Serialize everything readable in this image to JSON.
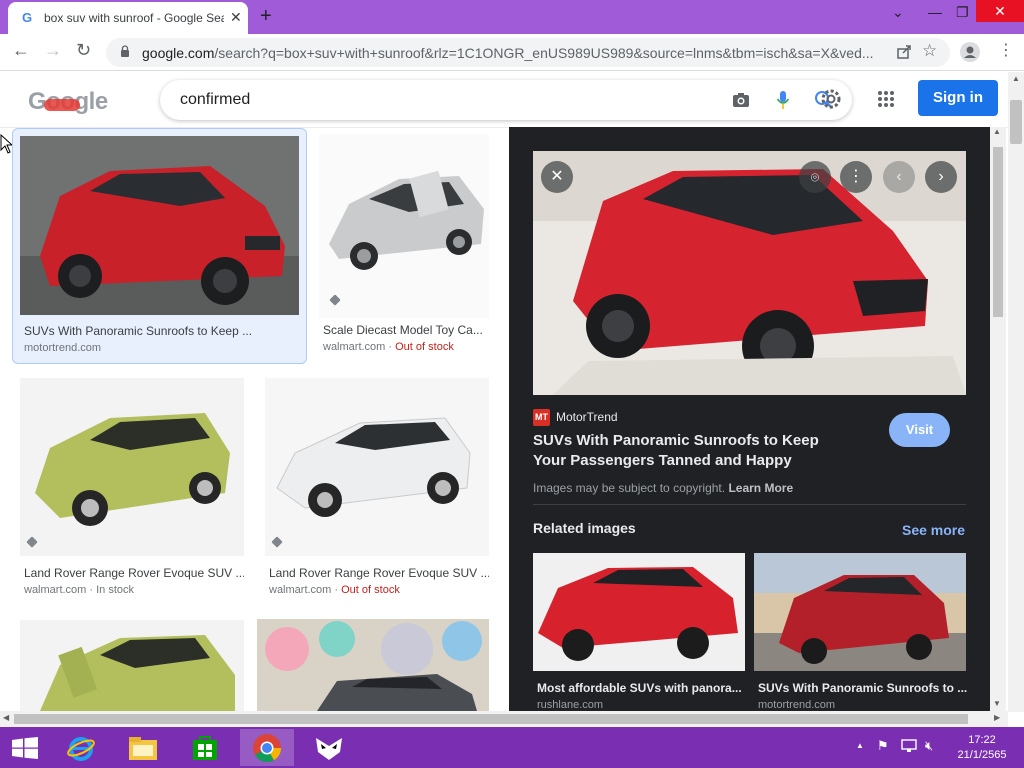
{
  "browser": {
    "tab_title": "box suv with sunroof - Google Search",
    "tab_favicon": "G",
    "url_main": "google.com",
    "url_rest": "/search?q=box+suv+with+sunroof&rlz=1C1ONGR_enUS989US989&source=lnms&tbm=isch&sa=X&ved..."
  },
  "google": {
    "logo": "Google",
    "search_text": "confirmed",
    "sign_in_label": "Sign in",
    "accent": "#1a73e8"
  },
  "results": [
    {
      "title": "SUVs With Panoramic Sunroofs to Keep ...",
      "source": "motortrend.com",
      "stock": "",
      "stock_sep": ""
    },
    {
      "title": "Scale Diecast Model Toy Ca...",
      "source": "walmart.com",
      "stock": "Out of stock",
      "stock_sep": " · "
    },
    {
      "title": "Land Rover Range Rover Evoque SUV ...",
      "source": "walmart.com",
      "stock": "In stock",
      "stock_sep": " · "
    },
    {
      "title": "Land Rover Range Rover Evoque SUV ...",
      "source": "walmart.com",
      "stock": "Out of stock",
      "stock_sep": " · "
    }
  ],
  "panel": {
    "source_icon": "MT",
    "source": "MotorTrend",
    "title": "SUVs With Panoramic Sunroofs to Keep Your Passengers Tanned and Happy",
    "visit_label": "Visit",
    "copyright": "Images may be subject to copyright.",
    "learn_more": "Learn More",
    "related_heading": "Related images",
    "see_more": "See more",
    "related": [
      {
        "title": "Most affordable SUVs with panora...",
        "source": "rushlane.com"
      },
      {
        "title": "SUVs With Panoramic Sunroofs to ...",
        "source": "motortrend.com"
      }
    ]
  },
  "taskbar": {
    "time": "17:22",
    "date": "21/1/2565"
  }
}
